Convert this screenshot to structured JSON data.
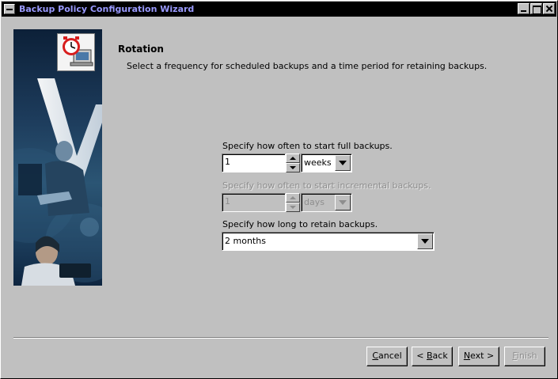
{
  "window": {
    "title": "Backup Policy Configuration Wizard"
  },
  "page": {
    "heading": "Rotation",
    "description": "Select a frequency for scheduled backups and a time period for retaining backups."
  },
  "full_backup": {
    "label": "Specify how often to start full backups.",
    "value": "1",
    "unit": "weeks"
  },
  "incremental_backup": {
    "label": "Specify how often to start incremental backups.",
    "value": "1",
    "unit": "days"
  },
  "retention": {
    "label": "Specify how long to retain backups.",
    "value": "2 months"
  },
  "buttons": {
    "cancel": {
      "mnemonic": "C",
      "rest": "ancel"
    },
    "back": {
      "prefix": "< ",
      "mnemonic": "B",
      "rest": "ack"
    },
    "next": {
      "mnemonic": "N",
      "rest": "ext >"
    },
    "finish": {
      "mnemonic": "F",
      "rest": "inish"
    }
  },
  "icons": {
    "system_menu": "system-menu-icon",
    "minimize": "minimize-icon",
    "maximize": "maximize-icon",
    "close": "close-icon",
    "clock_badge": "clock-monitor-icon"
  },
  "colors": {
    "title_text": "#9a9aff",
    "panel_bg": "#c0c0c0",
    "disabled_text": "#8e8e8e"
  }
}
